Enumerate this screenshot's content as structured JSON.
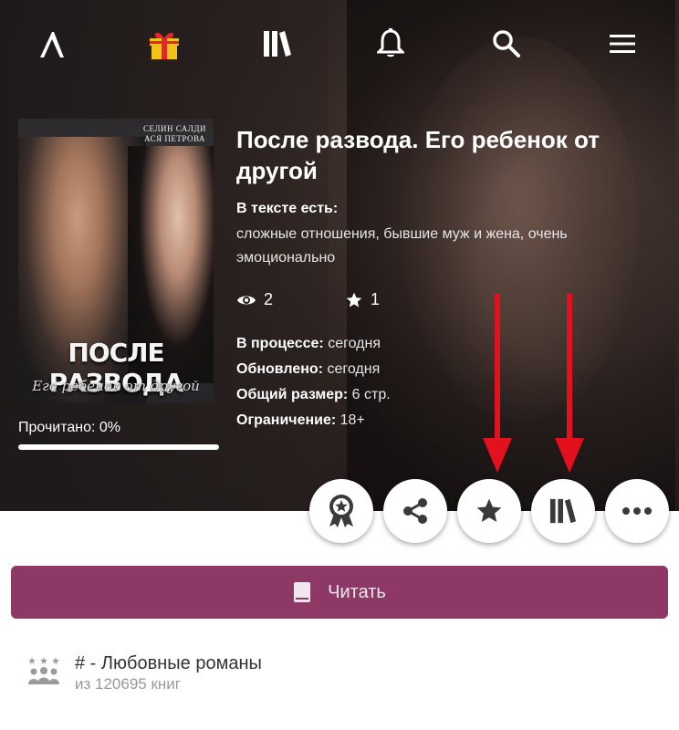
{
  "nav": {
    "icons": [
      "logo-icon",
      "gift-icon",
      "library-icon",
      "bell-icon",
      "search-icon",
      "menu-icon"
    ]
  },
  "cover": {
    "authors_line1": "СЕЛИН САЛДИ",
    "authors_line2": "АСЯ ПЕТРОВА",
    "title": "ПОСЛЕ РАЗВОДА",
    "subtitle": "Его ребенок от другой"
  },
  "progress": {
    "label": "Прочитано: 0%",
    "value": 0
  },
  "book": {
    "title": "После развода. Его ребенок от другой",
    "tags_label": "В тексте есть:",
    "tags": "сложные отношения, бывшие муж и жена, очень эмоционально",
    "views": "2",
    "rating": "1",
    "meta": [
      {
        "label": "В процессе:",
        "value": "сегодня"
      },
      {
        "label": "Обновлено:",
        "value": "сегодня"
      },
      {
        "label": "Общий размер:",
        "value": "6 стр."
      },
      {
        "label": "Ограничение:",
        "value": "18+"
      }
    ]
  },
  "actions": [
    "award-icon",
    "share-icon",
    "star-icon",
    "library-icon",
    "more-icon"
  ],
  "read_button": {
    "label": "Читать"
  },
  "genre": {
    "name": "#  - Любовные романы",
    "count": "из 120695 книг"
  },
  "colors": {
    "accent": "#8e3866",
    "arrow": "#e3101d"
  }
}
